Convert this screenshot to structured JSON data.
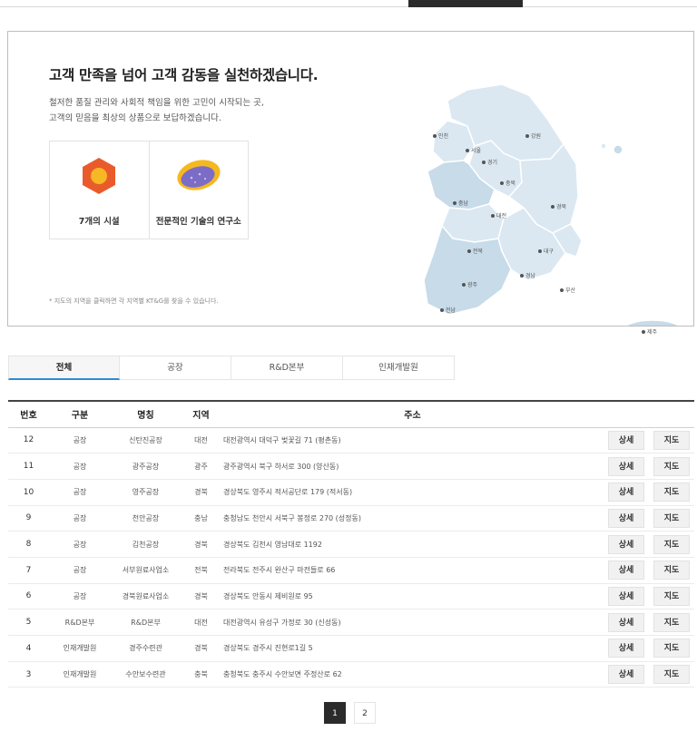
{
  "intro": {
    "title": "고객 만족을 넘어 고객 감동을 실천하겠습니다.",
    "desc_line1": "철저한 품질 관리와 사회적 책임을 위한 고민이 시작되는 곳,",
    "desc_line2": "고객의 믿음을 최상의 상품으로 보답하겠습니다.",
    "features": [
      {
        "label": "7개의 시설",
        "icon": "hexagon-facility-icon"
      },
      {
        "label": "전문적인 기술의 연구소",
        "icon": "petri-dish-lab-icon"
      }
    ],
    "map_note": "* 지도의 지역을 클릭하면 각 지역별 KT&G를 찾을 수 있습니다.",
    "map_labels": {
      "incheon": "인천",
      "seoul": "서울",
      "gyeonggi": "경기",
      "gangwon": "강원",
      "chungbuk": "충북",
      "chungnam": "충남",
      "daejeon": "대전",
      "gyeongbuk": "경북",
      "jeonbuk": "전북",
      "daegu": "대구",
      "gwangju": "광주",
      "gyeongnam": "경남",
      "busan": "부산",
      "jeonnam": "전남",
      "jeju": "제주"
    }
  },
  "tabs": [
    "전체",
    "공장",
    "R&D본부",
    "인재개발원"
  ],
  "table": {
    "headers": {
      "num": "번호",
      "type": "구분",
      "name": "명칭",
      "region": "지역",
      "address": "주소"
    },
    "detail_label": "상세",
    "map_label": "지도",
    "rows": [
      {
        "num": "12",
        "type": "공장",
        "name": "신탄진공장",
        "region": "대전",
        "address": "대전광역시 대덕구 벚꽃길 71 (평촌동)"
      },
      {
        "num": "11",
        "type": "공장",
        "name": "광주공장",
        "region": "광주",
        "address": "광주광역시 북구 하서로 300 (양산동)"
      },
      {
        "num": "10",
        "type": "공장",
        "name": "영주공장",
        "region": "경북",
        "address": "경상북도 영주시 적서공단로 179 (적서동)"
      },
      {
        "num": "9",
        "type": "공장",
        "name": "천안공장",
        "region": "충남",
        "address": "충청남도 천안시 서북구 봉정로 270 (성정동)"
      },
      {
        "num": "8",
        "type": "공장",
        "name": "김천공장",
        "region": "경북",
        "address": "경상북도 김천시 영남대로 1192"
      },
      {
        "num": "7",
        "type": "공장",
        "name": "서부원료사업소",
        "region": "전북",
        "address": "전라북도 전주시 완산구 마전들로 66"
      },
      {
        "num": "6",
        "type": "공장",
        "name": "경북원료사업소",
        "region": "경북",
        "address": "경상북도 안동시 제비원로 95"
      },
      {
        "num": "5",
        "type": "R&D본부",
        "name": "R&D본부",
        "region": "대전",
        "address": "대전광역시 유성구 가정로 30 (신성동)"
      },
      {
        "num": "4",
        "type": "인재개발원",
        "name": "경주수련관",
        "region": "경북",
        "address": "경상북도 경주시 진현로1길 5"
      },
      {
        "num": "3",
        "type": "인재개발원",
        "name": "수안보수련관",
        "region": "충북",
        "address": "충청북도 충주시 수안보면 주정산로 62"
      }
    ]
  },
  "pagination": {
    "pages": [
      "1",
      "2"
    ],
    "current": "1"
  },
  "colors": {
    "accent": "#2e8ccf",
    "dark": "#2b2b2b",
    "map_fill": "#dbe8f1",
    "map_fill_dark": "#c7dbe9",
    "hex_orange": "#ea5b2c",
    "dish_purple": "#7b6cc6"
  }
}
